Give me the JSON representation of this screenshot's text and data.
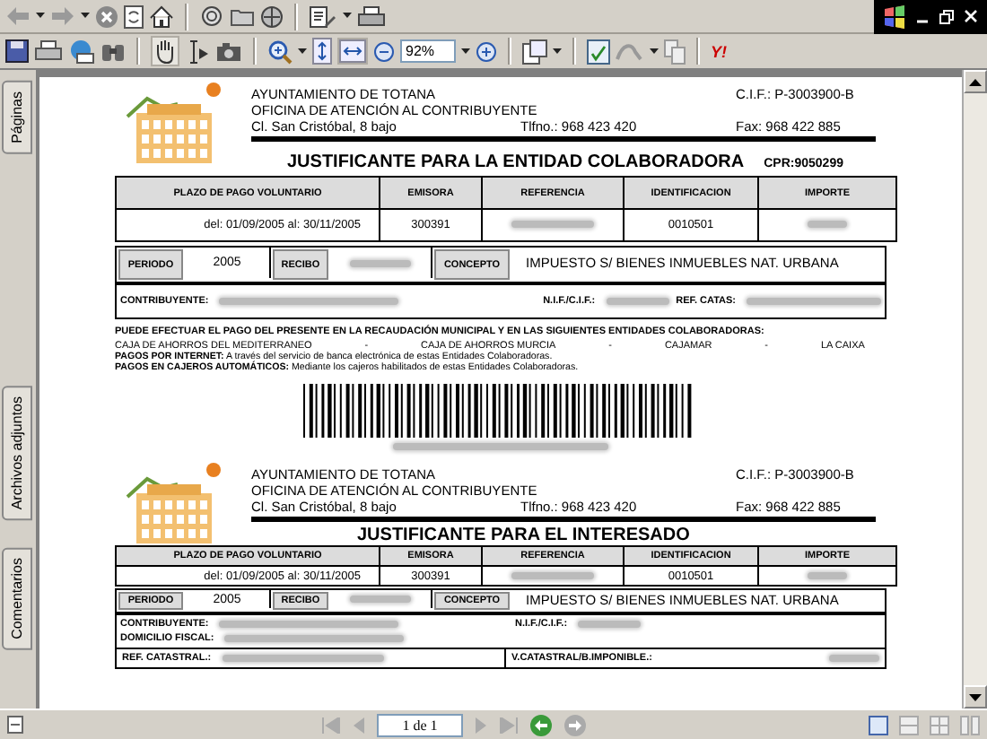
{
  "toolbar": {
    "zoom_field": {
      "value": "92%"
    },
    "brand_logo": "Y!"
  },
  "side_tabs": [
    {
      "label": "Páginas"
    },
    {
      "label": "Archivos adjuntos"
    },
    {
      "label": "Comentarios"
    }
  ],
  "receipts": [
    {
      "kind": "entity",
      "org": "AYUNTAMIENTO DE TOTANA",
      "office": "OFICINA DE ATENCIÓN AL CONTRIBUYENTE",
      "address": "Cl. San Cristóbal, 8 bajo",
      "phone": "Tlfno.: 968 423 420",
      "cif": "C.I.F.: P-3003900-B",
      "fax": "Fax: 968 422 885",
      "title": "JUSTIFICANTE PARA LA ENTIDAD COLABORADORA",
      "cpr": "CPR:9050299",
      "columns": [
        "PLAZO DE PAGO VOLUNTARIO",
        "EMISORA",
        "REFERENCIA",
        "IDENTIFICACION",
        "IMPORTE"
      ],
      "values": [
        {
          "text": "del: 01/09/2005 al: 30/11/2005"
        },
        {
          "text": "300391"
        },
        {
          "redacted": true
        },
        {
          "text": "0010501"
        },
        {
          "redacted": true
        }
      ],
      "period_row": [
        {
          "label": "PERIODO"
        },
        {
          "text": "2005"
        },
        {
          "label": "RECIBO"
        },
        {
          "redacted": true
        },
        {
          "label": "CONCEPTO"
        },
        {
          "text": "IMPUESTO S/ BIENES INMUEBLES NAT. URBANA"
        }
      ],
      "party_rows": [
        [
          {
            "label": "CONTRIBUYENTE:",
            "redacted": true
          },
          {
            "label": "N.I.F./C.I.F.:",
            "redacted": true
          },
          {
            "label": "REF. CATAS:",
            "redacted": true
          }
        ]
      ],
      "notice": "PUEDE EFECTUAR EL PAGO DEL PRESENTE EN LA RECAUDACIÓN MUNICIPAL Y EN LAS SIGUIENTES ENTIDADES COLABORADORAS:",
      "banks": [
        "CAJA DE AHORROS DEL MEDITERRANEO",
        "-",
        "CAJA DE AHORROS MURCIA",
        "-",
        "CAJAMAR",
        "-",
        "LA CAIXA"
      ],
      "payment_notes": [
        "**PAGOS POR INTERNET:** A través del servicio de banca electrónica de estas Entidades Colaboradoras.",
        "**PAGOS EN CAJEROS AUTOMÁTICOS:** Mediante los cajeros habilitados de estas Entidades Colaboradoras."
      ],
      "barcode": {
        "number_redacted": true
      }
    },
    {
      "kind": "taxpayer",
      "org": "AYUNTAMIENTO DE TOTANA",
      "office": "OFICINA DE ATENCIÓN AL CONTRIBUYENTE",
      "address": "Cl. San Cristóbal, 8 bajo",
      "phone": "Tlfno.: 968 423 420",
      "cif": "C.I.F.: P-3003900-B",
      "fax": "Fax: 968 422 885",
      "title": "JUSTIFICANTE PARA EL INTERESADO",
      "columns": [
        "PLAZO DE PAGO VOLUNTARIO",
        "EMISORA",
        "REFERENCIA",
        "IDENTIFICACION",
        "IMPORTE"
      ],
      "values": [
        {
          "text": "del: 01/09/2005 al: 30/11/2005"
        },
        {
          "text": "300391"
        },
        {
          "redacted": true
        },
        {
          "text": "0010501"
        },
        {
          "redacted": true
        }
      ],
      "period_row": [
        {
          "label": "PERIODO"
        },
        {
          "text": "2005"
        },
        {
          "label": "RECIBO"
        },
        {
          "redacted": true
        },
        {
          "label": "CONCEPTO"
        },
        {
          "text": "IMPUESTO S/ BIENES INMUEBLES NAT. URBANA"
        }
      ],
      "party_rows": [
        [
          {
            "label": "CONTRIBUYENTE:",
            "redacted": true
          },
          {
            "label": "N.I.F./C.I.F.:",
            "redacted": true
          }
        ],
        [
          {
            "label": "DOMICILIO FISCAL:",
            "redacted": true
          }
        ]
      ],
      "cadastral_cells": [
        {
          "label": "REF. CATASTRAL.:",
          "redacted": true
        },
        {
          "label": "V.CATASTRAL/B.IMPONIBLE.:",
          "redacted": true
        }
      ]
    }
  ],
  "status_bar": {
    "page_field": {
      "value": "1 de 1"
    }
  }
}
